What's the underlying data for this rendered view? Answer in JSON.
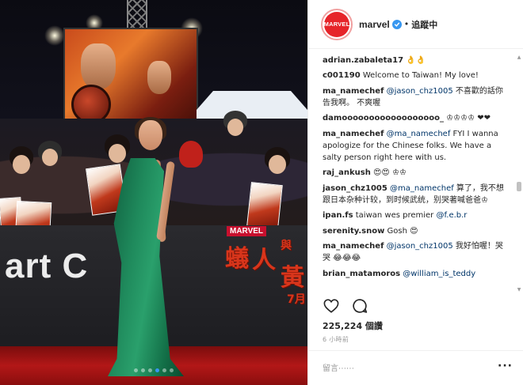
{
  "post": {
    "username": "marvel",
    "avatar_text": "MARVEL",
    "verified": true,
    "separator": "•",
    "follow_state": "追蹤中",
    "likes": "225,224 個讚",
    "time_ago": "6 小時前",
    "add_comment_placeholder": "留言⋯⋯",
    "more_options": "···"
  },
  "photo": {
    "wall_text": "art C",
    "film_title_chars": [
      "蟻",
      "人",
      "與",
      "黃"
    ],
    "logo_text": "MARVEL",
    "date_char": "7月",
    "carousel_dots": 6,
    "carousel_active": 3
  },
  "comments": [
    {
      "user": "adrian.zabaleta17",
      "text": " 👌👌"
    },
    {
      "user": "c001190",
      "text": " Welcome to Taiwan! My love!"
    },
    {
      "user": "ma_namechef",
      "mention": " @jason_chz1005",
      "text": " 不喜歡的話你告我啊。 不爽喔"
    },
    {
      "user": "damoooooooooooooooooo_",
      "text": " ♔♔♔♔ ❤❤"
    },
    {
      "user": "ma_namechef",
      "mention": " @ma_namechef",
      "text": " FYI I wanna apologize for the Chinese folks. We have a salty person right here with us."
    },
    {
      "user": "raj_ankush",
      "text": " 😍😍 ♔♔"
    },
    {
      "user": "jason_chz1005",
      "mention": " @ma_namechef",
      "text": " 算了，我不想跟日本杂种计较，到时候武统，别哭著喊爸爸♔"
    },
    {
      "user": "ipan.fs",
      "text": " taiwan wes premier ",
      "trailing_mention": "@f.e.b.r"
    },
    {
      "user": "serenity.snow",
      "text": " Gosh 😍"
    },
    {
      "user": "ma_namechef",
      "mention": " @jason_chz1005",
      "text": " 我好怕喔！哭哭 😂😂😂"
    },
    {
      "user": "brian_matamoros",
      "mention": " @william_is_teddy",
      "text": ""
    }
  ],
  "icons": {
    "heart": "heart-icon",
    "comment": "comment-icon",
    "verified": "verified-badge-icon"
  },
  "colors": {
    "brand": "#e62429",
    "link": "#003569",
    "verified": "#3897f0",
    "gown": "#1f8a5c",
    "carpet": "#b21717"
  }
}
